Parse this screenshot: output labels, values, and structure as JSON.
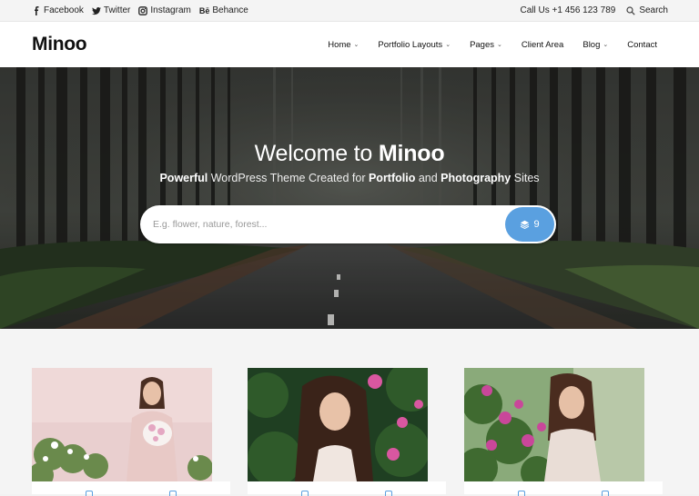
{
  "topbar": {
    "social": [
      {
        "label": "Facebook",
        "icon": "facebook-icon"
      },
      {
        "label": "Twitter",
        "icon": "twitter-icon"
      },
      {
        "label": "Instagram",
        "icon": "instagram-icon"
      },
      {
        "label": "Behance",
        "icon": "behance-icon"
      }
    ],
    "call": "Call Us +1 456 123 789",
    "search_label": "Search"
  },
  "header": {
    "logo": "Minoo",
    "nav": [
      {
        "label": "Home",
        "dropdown": true
      },
      {
        "label": "Portfolio Layouts",
        "dropdown": true
      },
      {
        "label": "Pages",
        "dropdown": true
      },
      {
        "label": "Client Area",
        "dropdown": false
      },
      {
        "label": "Blog",
        "dropdown": true
      },
      {
        "label": "Contact",
        "dropdown": false
      }
    ]
  },
  "hero": {
    "title_prefix": "Welcome to ",
    "title_brand": "Minoo",
    "subtitle": {
      "w1": "Powerful",
      "t1": " WordPress Theme Created for ",
      "w2": "Portfolio",
      "t2": " and ",
      "w3": "Photography",
      "t3": " Sites"
    },
    "search_placeholder": "E.g. flower, nature, forest...",
    "search_count": "9"
  },
  "colors": {
    "accent": "#5aa0e0",
    "topbar_bg": "#f4f4f4",
    "header_bg": "#ffffff"
  }
}
